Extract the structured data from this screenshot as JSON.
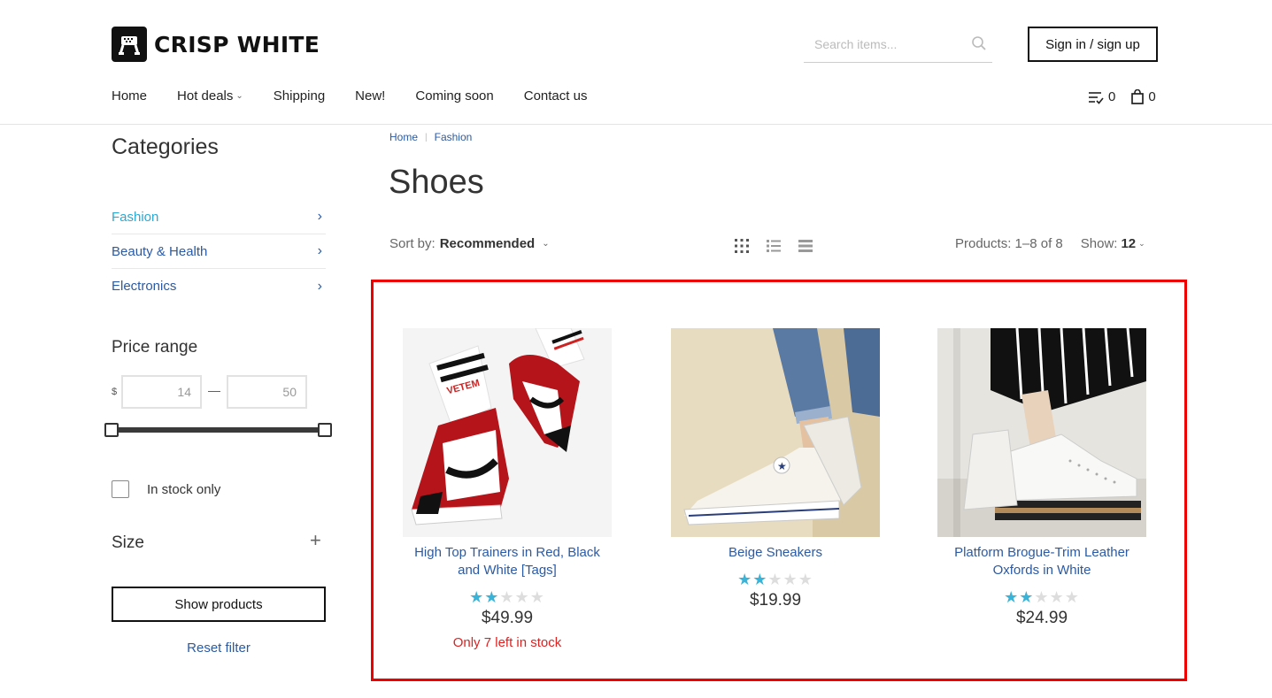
{
  "brand": {
    "name": "CRISP WHITE"
  },
  "search": {
    "placeholder": "Search items..."
  },
  "auth": {
    "signin_label": "Sign in / sign up"
  },
  "nav": {
    "items": [
      {
        "label": "Home"
      },
      {
        "label": "Hot deals",
        "has_caret": true
      },
      {
        "label": "Shipping"
      },
      {
        "label": "New!"
      },
      {
        "label": "Coming soon"
      },
      {
        "label": "Contact us"
      }
    ]
  },
  "header_counts": {
    "wishlist": "0",
    "cart": "0"
  },
  "sidebar": {
    "categories_title": "Categories",
    "categories": [
      {
        "label": "Fashion",
        "active": true
      },
      {
        "label": "Beauty & Health"
      },
      {
        "label": "Electronics"
      }
    ],
    "price_title": "Price range",
    "currency": "$",
    "price_from": "14",
    "price_to": "50",
    "price_dash": "—",
    "stock_label": "In stock only",
    "size_title": "Size",
    "show_button": "Show products",
    "reset_link": "Reset filter"
  },
  "breadcrumb": {
    "home": "Home",
    "current": "Fashion"
  },
  "page_title": "Shoes",
  "toolbar": {
    "sort_label": "Sort by:",
    "sort_value": "Recommended",
    "products_count": "Products: 1–8 of 8",
    "show_label": "Show:",
    "show_value": "12"
  },
  "products": [
    {
      "name": "High Top Trainers in Red, Black and White [Tags]",
      "rating": 2,
      "price": "$49.99",
      "stock_note": "Only 7 left in stock"
    },
    {
      "name": "Beige Sneakers",
      "rating": 2,
      "price": "$19.99"
    },
    {
      "name": "Platform Brogue-Trim Leather Oxfords in White",
      "rating": 2,
      "price": "$24.99"
    }
  ],
  "colors": {
    "link": "#2a5aa5",
    "active_link": "#2aa9d2",
    "star": "#3ab3d8",
    "warning": "#dd2222",
    "highlight": "#ee0000"
  }
}
